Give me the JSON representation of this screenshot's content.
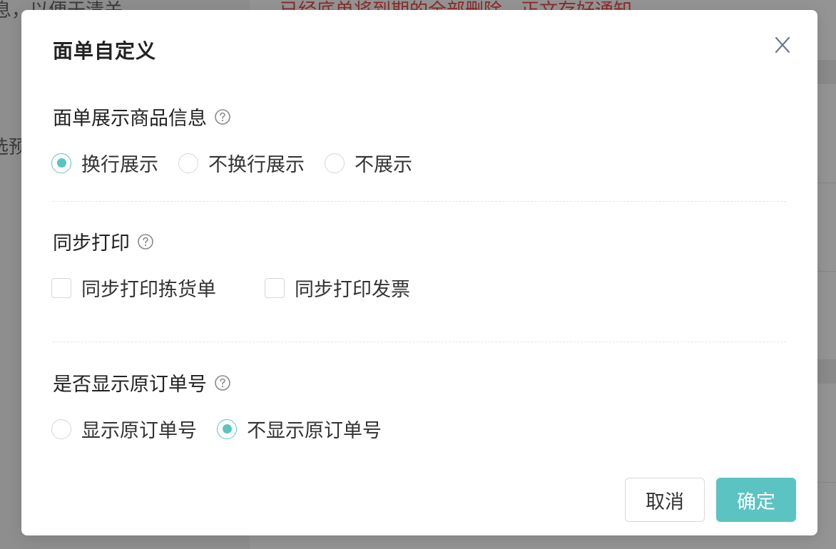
{
  "background": {
    "left_line1": "息，以便于清关",
    "left_line2": "选预",
    "top_red_text": "已经底单将到期的全部删除，正文存好通知"
  },
  "dialog": {
    "title": "面单自定义",
    "close_icon": "close-icon"
  },
  "product_info": {
    "title": "面单展示商品信息",
    "help_icon": "help-circle-icon",
    "options": [
      {
        "label": "换行展示",
        "checked": true
      },
      {
        "label": "不换行展示",
        "checked": false
      },
      {
        "label": "不展示",
        "checked": false
      }
    ]
  },
  "sync_print": {
    "title": "同步打印",
    "help_icon": "help-circle-icon",
    "options": [
      {
        "label": "同步打印拣货单",
        "checked": false
      },
      {
        "label": "同步打印发票",
        "checked": false
      }
    ]
  },
  "original_order": {
    "title": "是否显示原订单号",
    "help_icon": "help-circle-icon",
    "options": [
      {
        "label": "显示原订单号",
        "checked": false
      },
      {
        "label": "不显示原订单号",
        "checked": true
      }
    ]
  },
  "footer": {
    "cancel_label": "取消",
    "ok_label": "确定"
  },
  "colors": {
    "accent": "#5cc3c3",
    "overlay": "#8e8e8e"
  }
}
